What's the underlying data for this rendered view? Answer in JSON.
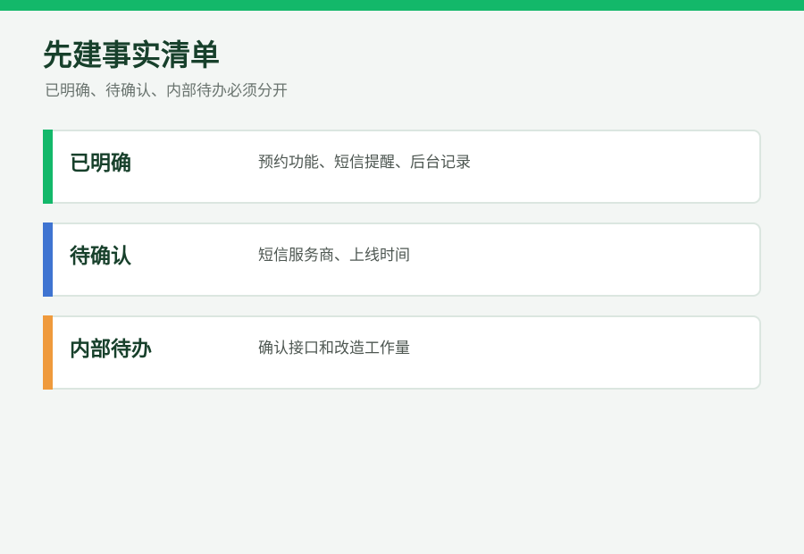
{
  "colors": {
    "top_bar": "#13b86a",
    "background": "#f3f6f4",
    "title_text": "#17402b",
    "confirmed_accent": "#13b86a",
    "pending_accent": "#3f74d1",
    "internal_accent": "#ef9a3c"
  },
  "header": {
    "title": "先建事实清单",
    "subtitle": "已明确、待确认、内部待办必须分开"
  },
  "cards": [
    {
      "label": "已明确",
      "detail": "预约功能、短信提醒、后台记录",
      "accent": "#13b86a"
    },
    {
      "label": "待确认",
      "detail": "短信服务商、上线时间",
      "accent": "#3f74d1"
    },
    {
      "label": "内部待办",
      "detail": "确认接口和改造工作量",
      "accent": "#ef9a3c"
    }
  ]
}
